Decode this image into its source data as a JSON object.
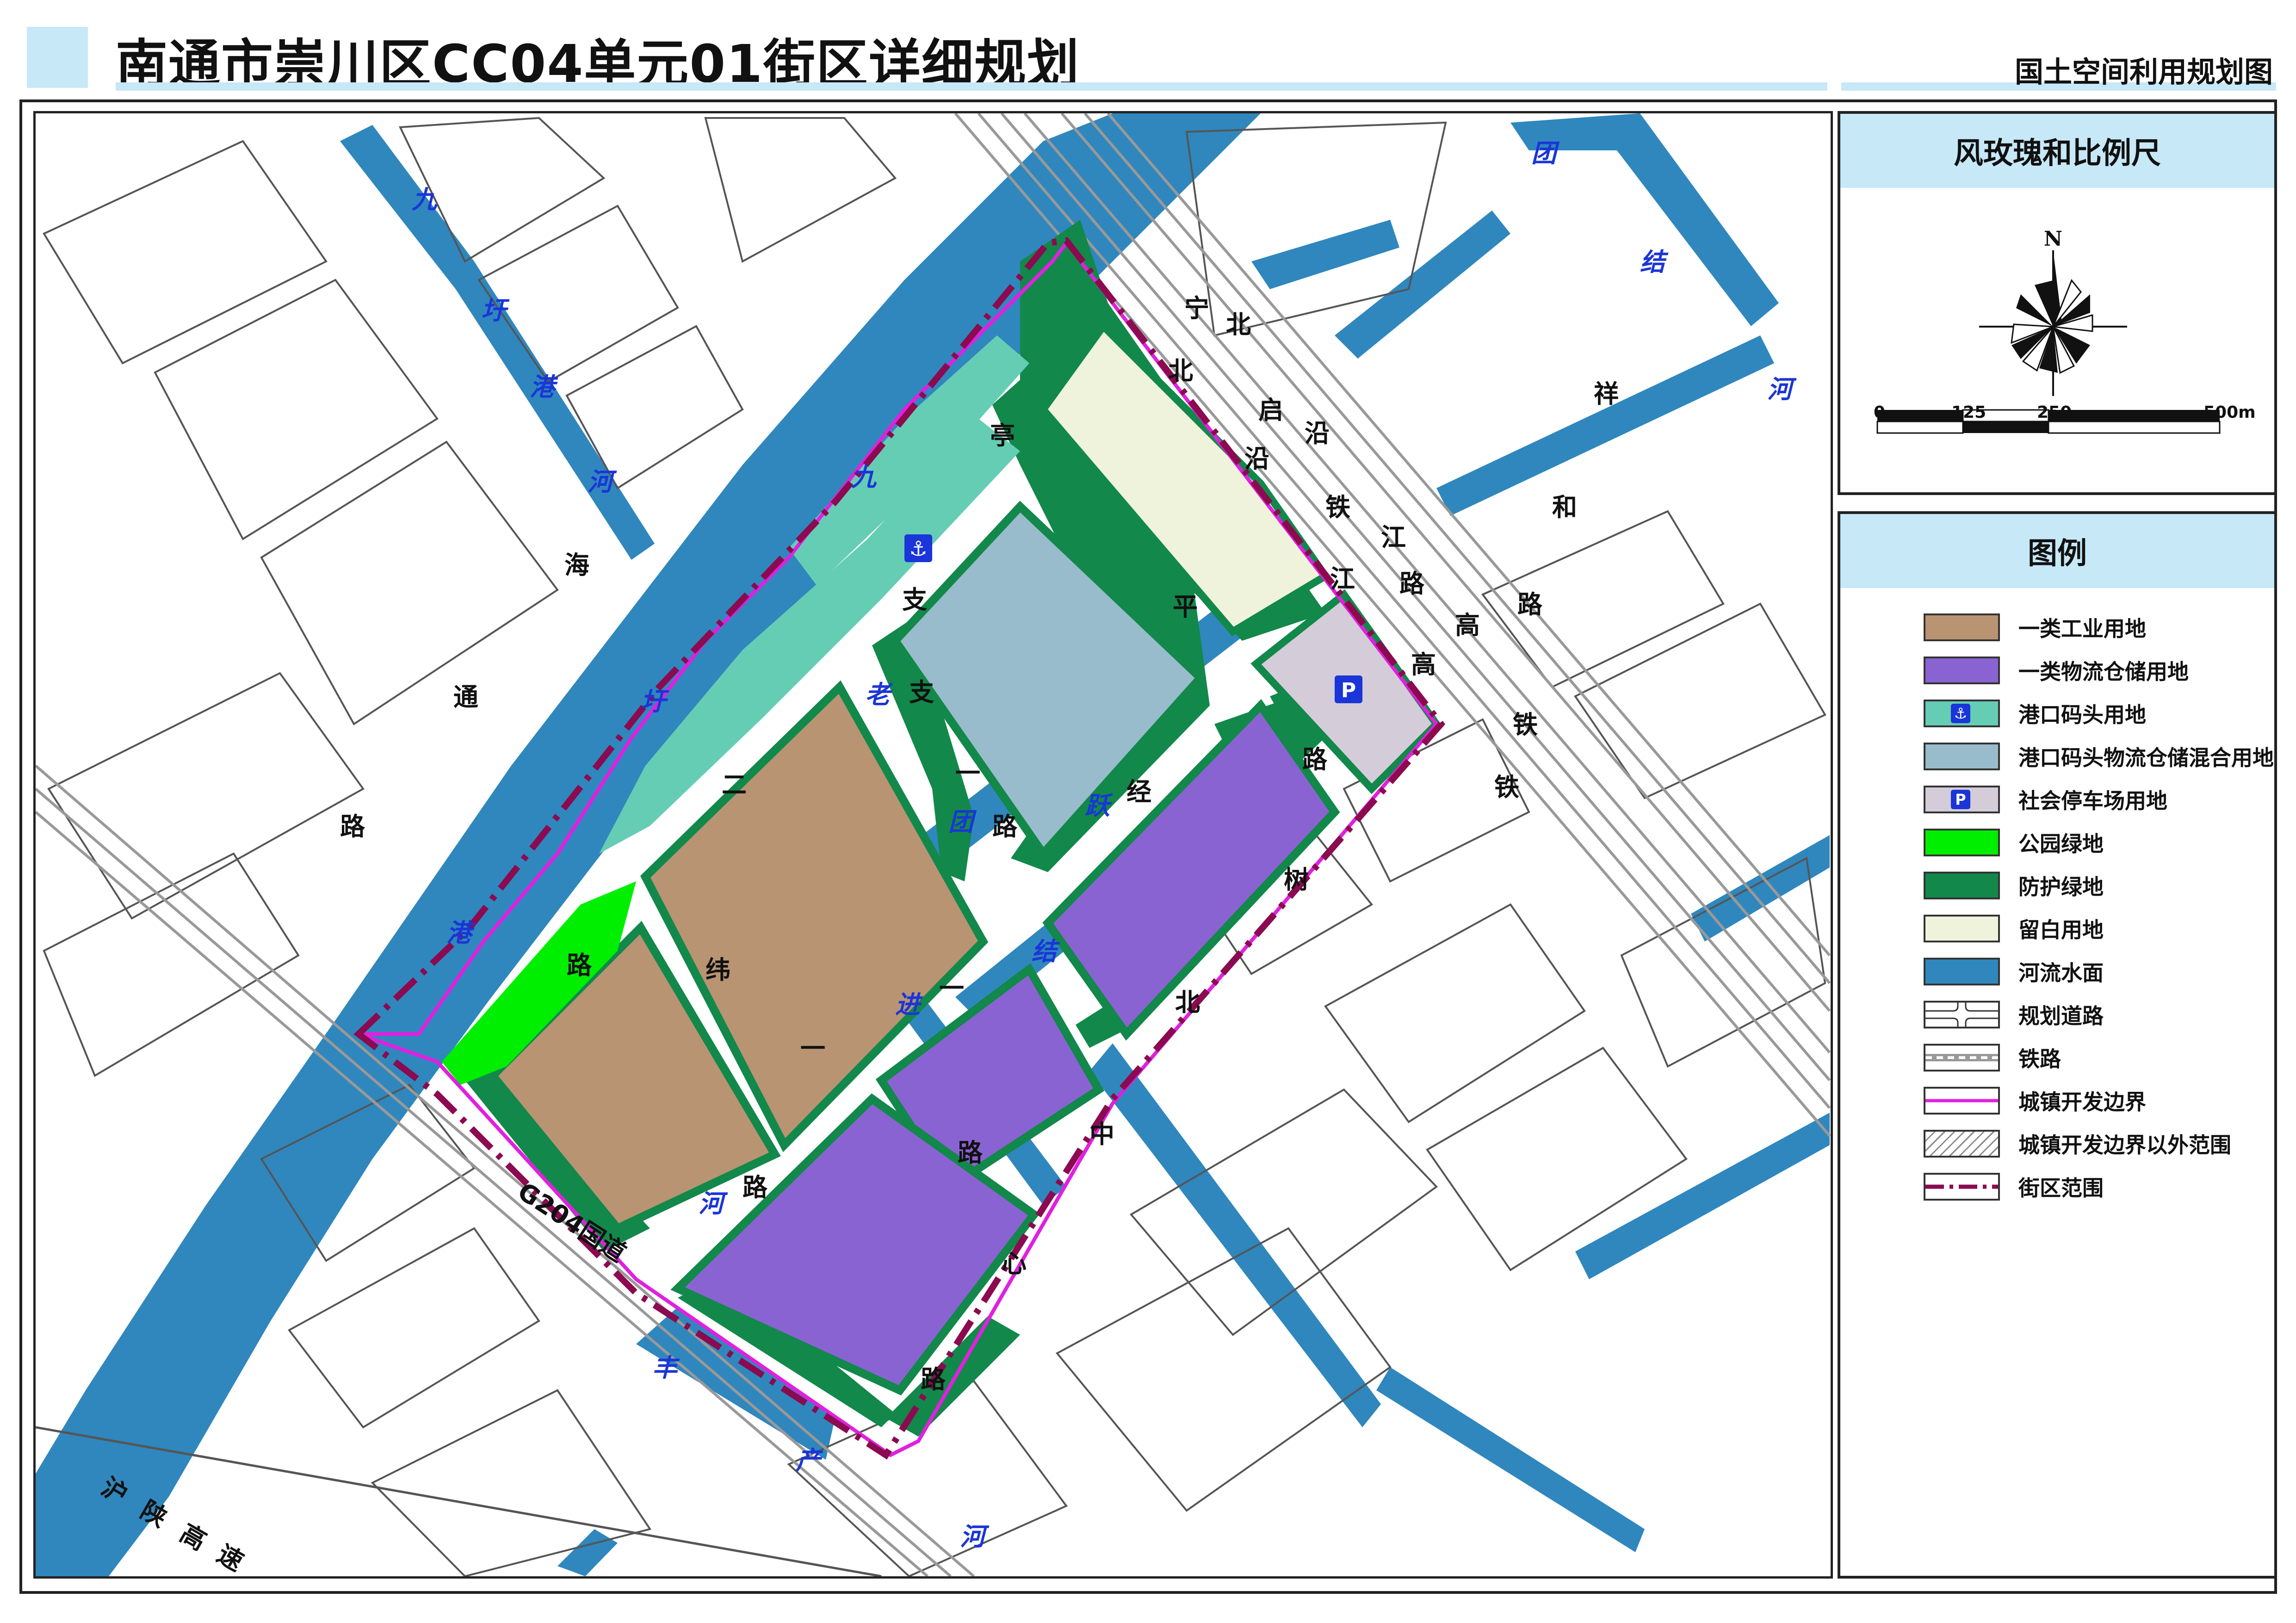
{
  "header": {
    "title": "南通市崇川区CC04单元01街区详细规划",
    "map_type": "国土空间利用规划图"
  },
  "compass_panel": {
    "title": "风玫瑰和比例尺",
    "north": "N",
    "scale_labels": [
      "0",
      "125",
      "250",
      "500m"
    ]
  },
  "legend": {
    "title": "图例",
    "items": [
      {
        "label": "一类工业用地",
        "color": "#b89472"
      },
      {
        "label": "一类物流仓储用地",
        "color": "#8a63d2"
      },
      {
        "label": "港口码头用地",
        "color": "#66cdb5",
        "icon": "anchor-icon"
      },
      {
        "label": "港口码头物流仓储混合用地",
        "color": "#98bccb"
      },
      {
        "label": "社会停车场用地",
        "color": "#d4ccd9",
        "icon": "parking-icon"
      },
      {
        "label": "公园绿地",
        "color": "#00ee00"
      },
      {
        "label": "防护绿地",
        "color": "#12884a"
      },
      {
        "label": "留白用地",
        "color": "#f0f3dc"
      },
      {
        "label": "河流水面",
        "color": "#2f87bd"
      },
      {
        "label": "规划道路",
        "color": "#ffffff"
      },
      {
        "label": "铁路",
        "color": "#999999"
      },
      {
        "label": "城镇开发边界",
        "color": "#e020e0"
      },
      {
        "label": "城镇开发边界以外范围",
        "color": "#ffffff"
      },
      {
        "label": "街区范围",
        "color": "#8b0a50"
      }
    ]
  },
  "map_labels": {
    "jiuyu_river_top": [
      "九",
      "圩",
      "港",
      "河"
    ],
    "jiuyu_river_main": [
      "九",
      "圩",
      "港"
    ],
    "haitong_road": [
      "海",
      "通",
      "路"
    ],
    "erzhi_road": [
      "二",
      "路"
    ],
    "zhi_road_upper": [
      "亭",
      "支"
    ],
    "zhi_road_lower": [
      "支",
      "一",
      "路"
    ],
    "tuanjie_old": [
      "老",
      "团",
      "结"
    ],
    "yuejin_river": [
      "跃",
      "进",
      "河"
    ],
    "wei_road": [
      "纬",
      "一",
      "路"
    ],
    "jing_road": [
      "经",
      "一",
      "路"
    ],
    "ningqi": [
      "宁",
      "北",
      "启",
      "北",
      "沿",
      "铁",
      "江",
      "高"
    ],
    "pingjiang": [
      "平",
      "江",
      "路"
    ],
    "gao_tie": [
      "高",
      "铁",
      "铁"
    ],
    "xianghe_road": [
      "祥",
      "和",
      "路"
    ],
    "tuanjie_river": [
      "团",
      "结",
      "河"
    ],
    "shubei_road": [
      "树",
      "北",
      "中",
      "心",
      "路"
    ],
    "g204": "G204国道",
    "fengchan_river": [
      "丰",
      "产",
      "河"
    ],
    "huyan_highway": [
      "沪",
      "陕",
      "高",
      "速"
    ],
    "lu": "路",
    "he": "河"
  }
}
